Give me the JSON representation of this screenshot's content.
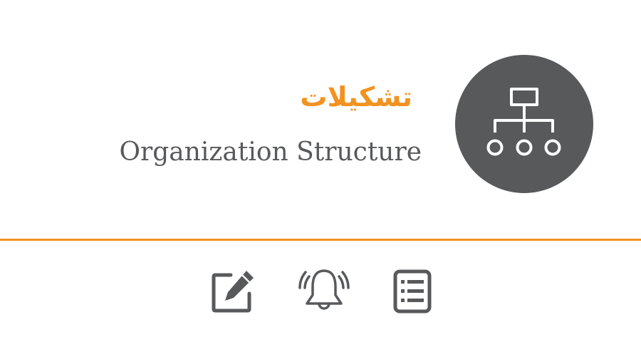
{
  "header": {
    "title_fa": "تشکیلات",
    "title_en": "Organization Structure"
  },
  "badge": {
    "icon": "org-chart-icon"
  },
  "toolbar": {
    "actions": [
      {
        "icon": "edit-icon"
      },
      {
        "icon": "bell-icon"
      },
      {
        "icon": "list-icon"
      }
    ]
  },
  "colors": {
    "accent": "#f29220",
    "text": "#58595b",
    "badge": "#58595b",
    "icon": "#58595b",
    "background": "#ffffff"
  }
}
